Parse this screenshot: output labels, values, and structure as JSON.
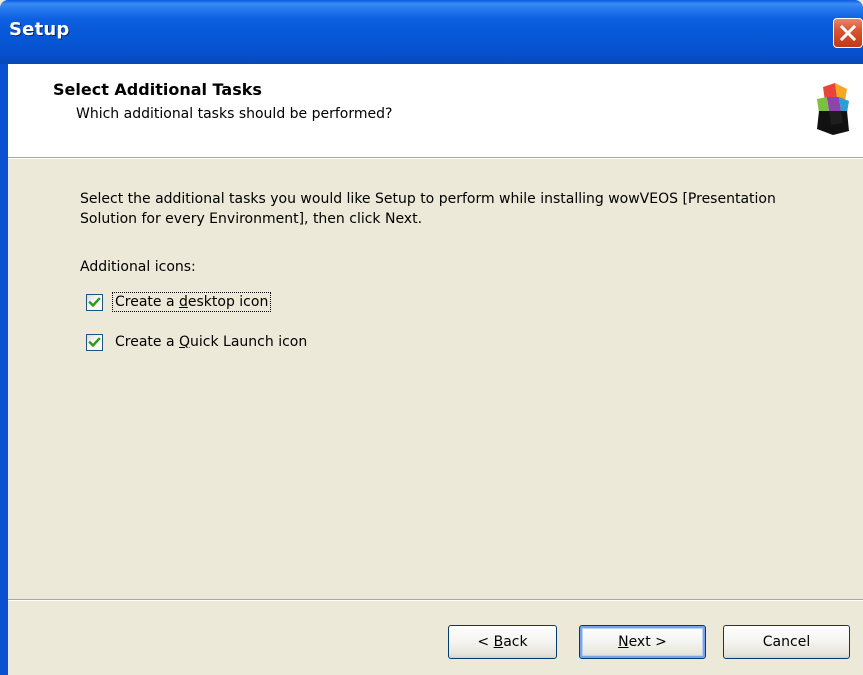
{
  "window": {
    "title": "Setup"
  },
  "header": {
    "title": "Select Additional Tasks",
    "subtitle": "Which additional tasks should be performed?",
    "logo_icon": "setup-logo-icon"
  },
  "body": {
    "description": "Select the additional tasks you would like Setup to perform while installing wowVEOS [Presentation Solution for every Environment], then click Next.",
    "group_label": "Additional icons:",
    "tasks": [
      {
        "label_before": "Create a ",
        "accel": "d",
        "label_after": "esktop icon",
        "checked": true,
        "focused": true
      },
      {
        "label_before": "Create a ",
        "accel": "Q",
        "label_after": "uick Launch icon",
        "checked": true,
        "focused": false
      }
    ]
  },
  "footer": {
    "back": {
      "prefix": "< ",
      "accel": "B",
      "rest": "ack"
    },
    "next": {
      "accel": "N",
      "rest": "ext",
      "suffix": " >"
    },
    "cancel": "Cancel"
  },
  "colors": {
    "titlebar": "#0a5be0",
    "close_button": "#d8552f",
    "dialog_face": "#ece9d8",
    "check": "#21a121"
  }
}
